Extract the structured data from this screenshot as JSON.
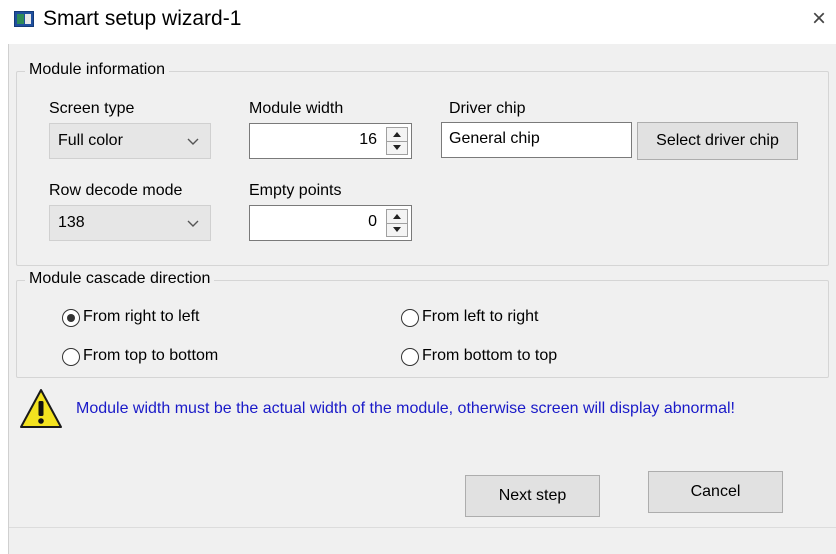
{
  "window": {
    "title": "Smart setup wizard-1",
    "close_glyph": "×",
    "app_icon": "app-window-icon"
  },
  "module_info": {
    "group_title": "Module information",
    "screen_type": {
      "label": "Screen type",
      "value": "Full color"
    },
    "module_width": {
      "label": "Module width",
      "value": "16"
    },
    "driver_chip": {
      "label": "Driver chip",
      "value": "General chip",
      "button_label": "Select driver chip"
    },
    "row_decode": {
      "label": "Row decode mode",
      "value": "138"
    },
    "empty_points": {
      "label": "Empty points",
      "value": "0"
    }
  },
  "cascade": {
    "group_title": "Module cascade direction",
    "options": [
      {
        "label": "From right to left",
        "selected": true
      },
      {
        "label": "From left to right",
        "selected": false
      },
      {
        "label": "From top to bottom",
        "selected": false
      },
      {
        "label": "From bottom to top",
        "selected": false
      }
    ]
  },
  "warning": {
    "icon": "warning-icon",
    "text": "Module width must be the actual width of the module, otherwise screen will display abnormal!",
    "text_color": "#1a1ac8"
  },
  "buttons": {
    "next_label": "Next step",
    "cancel_label": "Cancel"
  }
}
